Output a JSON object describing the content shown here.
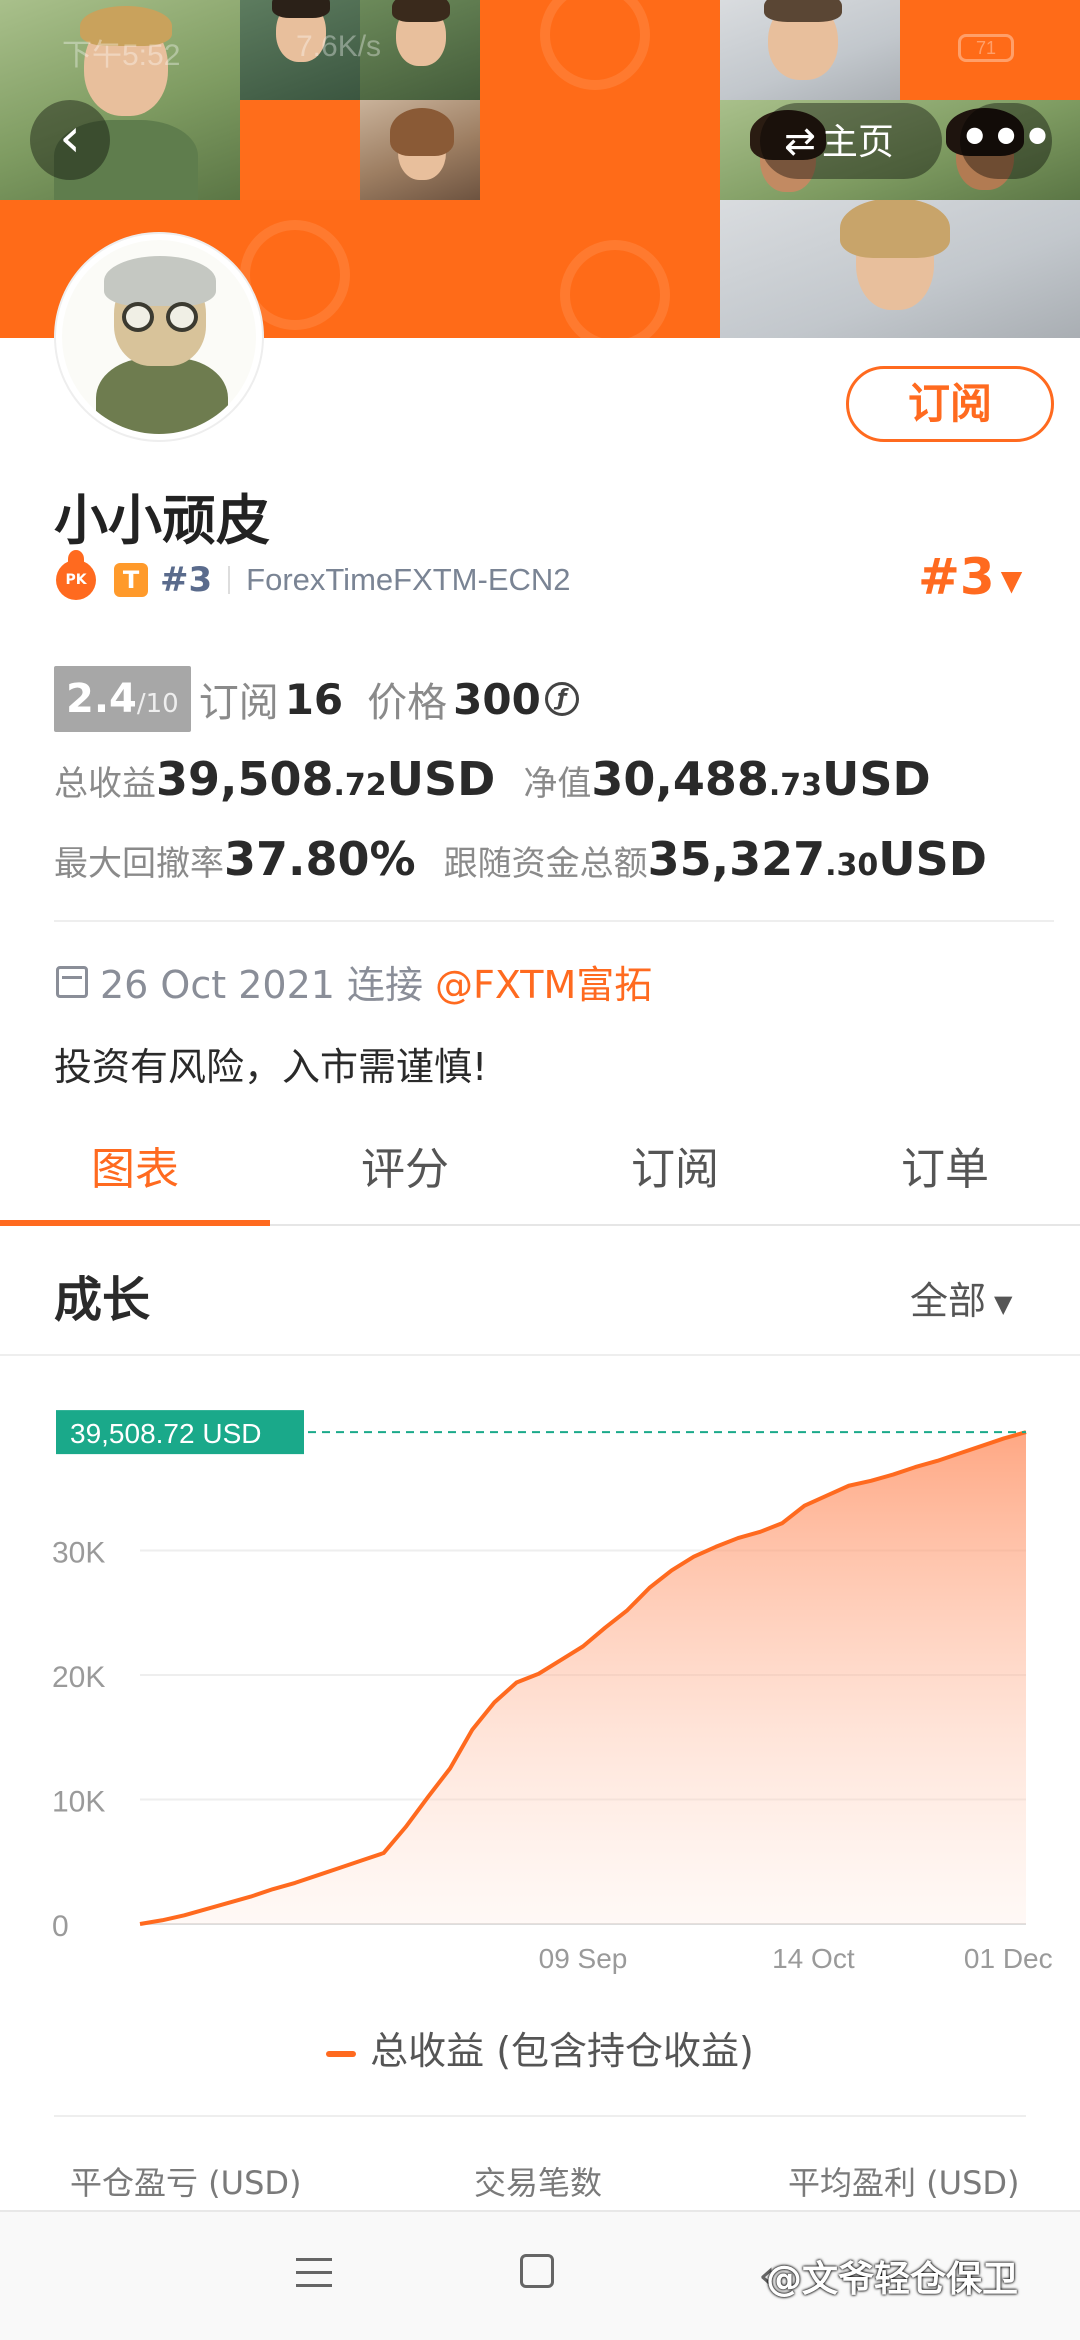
{
  "status_bar": {
    "time": "下午5:52",
    "speed": "7.6K/s",
    "battery": "71"
  },
  "header": {
    "home_label": "主页",
    "back_icon": "chevron-left-icon",
    "more_icon": "more-dots-icon",
    "accent_color": "#ff6a1f"
  },
  "profile": {
    "subscribe_label": "订阅",
    "name": "小小顽皮",
    "pk_badge": "PK",
    "t_badge": "T",
    "rank_small": "#3",
    "broker": "ForexTimeFXTM-ECN2",
    "rank_big": "#3"
  },
  "stats": {
    "score": "2.4",
    "score_max": "/10",
    "subscribe_label": "订阅",
    "subscribe_count": "16",
    "price_label": "价格",
    "price_value": "300",
    "total_profit_label": "总收益",
    "total_profit_int": "39,508",
    "total_profit_dec": ".72",
    "total_profit_unit": " USD",
    "equity_label": "净值",
    "equity_int": "30,488",
    "equity_dec": ".73",
    "equity_unit": " USD",
    "drawdown_label": "最大回撤率",
    "drawdown_value": "37.80%",
    "follow_label": "跟随资金总额",
    "follow_int": "35,327",
    "follow_dec": ".30",
    "follow_unit": " USD"
  },
  "join": {
    "date": "26 Oct 2021 连接",
    "broker_link": "@FXTM富拓"
  },
  "risk_notice": "投资有风险，入市需谨慎!",
  "tabs": [
    {
      "label": "图表",
      "active": true
    },
    {
      "label": "评分",
      "active": false
    },
    {
      "label": "订阅",
      "active": false
    },
    {
      "label": "订单",
      "active": false
    }
  ],
  "growth": {
    "title": "成长",
    "range": "全部"
  },
  "chart_data": {
    "type": "area",
    "series": [
      {
        "name": "总收益 (包含持仓收益)",
        "color": "#ff6a1f",
        "x": [
          0,
          5,
          10,
          15,
          20,
          25,
          30,
          35,
          40,
          45,
          50,
          55,
          60,
          65,
          70,
          75,
          80,
          85,
          90,
          95,
          100,
          105,
          110,
          115,
          120,
          125,
          130,
          135,
          140,
          145,
          150,
          155,
          160,
          165,
          170,
          175,
          180,
          185,
          190,
          195,
          200
        ],
        "y": [
          0,
          300,
          700,
          1200,
          1700,
          2200,
          2800,
          3300,
          3900,
          4500,
          5100,
          5700,
          7800,
          10200,
          12500,
          15600,
          17800,
          19400,
          20100,
          21200,
          22300,
          23800,
          25200,
          27000,
          28400,
          29500,
          30300,
          31000,
          31500,
          32200,
          33600,
          34400,
          35200,
          35600,
          36100,
          36700,
          37200,
          37800,
          38400,
          39000,
          39508.72
        ]
      }
    ],
    "x_ticks": [
      "09 Sep",
      "14 Oct",
      "01 Dec"
    ],
    "y_ticks": [
      "0",
      "10K",
      "20K",
      "30K"
    ],
    "ylim": [
      0,
      40000
    ],
    "current_value_label": "39,508.72 USD",
    "legend": "总收益 (包含持仓收益)",
    "grid": true
  },
  "summary_headers": {
    "closed_pnl": "平仓盈亏 (USD)",
    "trade_count": "交易笔数",
    "avg_profit": "平均盈利 (USD)"
  },
  "navbar": {
    "menu_icon": "menu-icon",
    "home_icon": "home-square-icon",
    "back_icon": "back-chevron-icon",
    "watermark": "@文爷轻仓保卫"
  }
}
